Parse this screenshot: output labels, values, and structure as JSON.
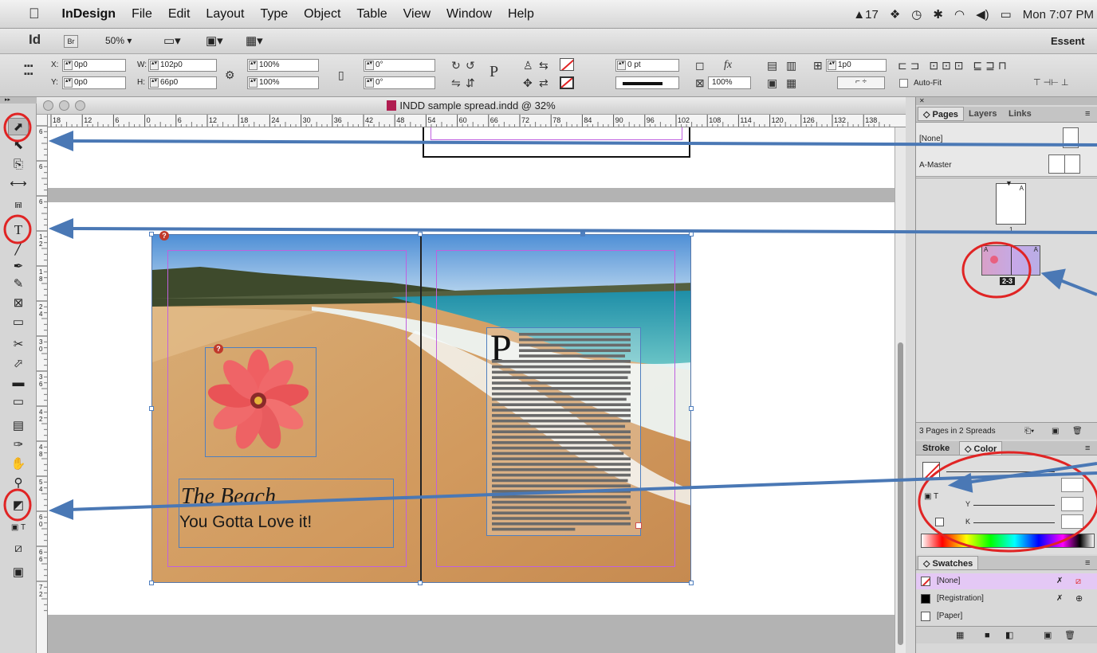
{
  "menubar": {
    "apple": "",
    "app_name": "InDesign",
    "items": [
      "File",
      "Edit",
      "Layout",
      "Type",
      "Object",
      "Table",
      "View",
      "Window",
      "Help"
    ],
    "status_num": "17",
    "clock": "Mon 7:07 PM"
  },
  "appbar": {
    "logo": "Id",
    "bridge": "Br",
    "zoom": "50%",
    "workspace": "Essent"
  },
  "control": {
    "x_label": "X:",
    "x_value": "0p0",
    "y_label": "Y:",
    "y_value": "0p0",
    "w_label": "W:",
    "w_value": "102p0",
    "h_label": "H:",
    "h_value": "66p0",
    "scale_x": "100%",
    "scale_y": "100%",
    "rotate": "0°",
    "shear": "0°",
    "stroke_weight": "0 pt",
    "opacity": "100%",
    "columns_gutter": "1p0",
    "autofit_label": "Auto-Fit"
  },
  "document": {
    "title": "INDD sample spread.indd @ 32%",
    "hruler_ticks": [
      "18",
      "12",
      "6",
      "0",
      "6",
      "12",
      "18",
      "24",
      "30",
      "36",
      "42",
      "48",
      "54",
      "60",
      "66",
      "72",
      "78",
      "84",
      "90",
      "96",
      "102",
      "108",
      "114",
      "120",
      "126",
      "132",
      "138"
    ],
    "vruler_ticks": [
      "6",
      "6",
      "6",
      "1\n2",
      "1\n8",
      "2\n4",
      "3\n0",
      "3\n6",
      "4\n2",
      "4\n8",
      "5\n4",
      "6\n0",
      "6\n6",
      "7\n2"
    ],
    "headline": "The Beach",
    "subhead": "You Gotta Love it!",
    "dropcap": "P"
  },
  "pages_panel": {
    "tabs": [
      "Pages",
      "Layers",
      "Links"
    ],
    "none_label": "[None]",
    "master_label": "A-Master",
    "page1_num": "1",
    "spread_label": "2-3",
    "footer": "3 Pages in 2 Spreads"
  },
  "color_panel": {
    "tabs": [
      "Stroke",
      "Color"
    ],
    "channels": [
      "Y",
      "K"
    ]
  },
  "swatches_panel": {
    "tab": "Swatches",
    "items": [
      "[None]",
      "[Registration]",
      "[Paper]"
    ]
  },
  "colors": {
    "annotation_red": "#e02424",
    "annotation_blue": "#4a78b5",
    "margin_magenta": "#c060e0",
    "frame_blue": "#4f7fbf",
    "selected_swatch": "#e4c8f5"
  }
}
